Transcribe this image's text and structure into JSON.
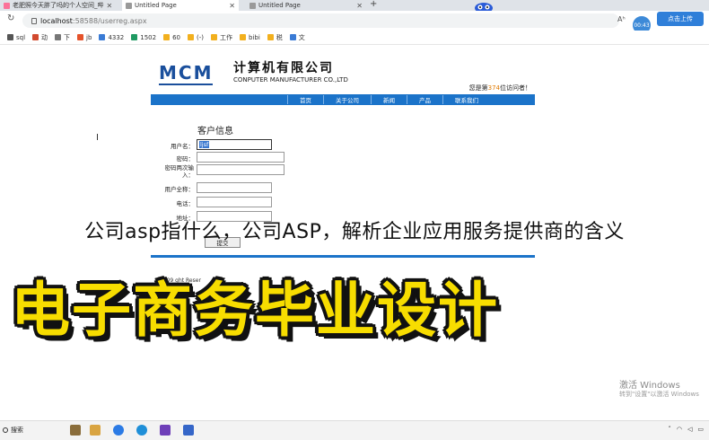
{
  "browser": {
    "tabs": [
      {
        "title": "老肥照今天胖了吗的个人空间_哔"
      },
      {
        "title": "Untitled Page"
      },
      {
        "title": "Untitled Page"
      }
    ],
    "new_tab": "+",
    "url_host": "localhost",
    "url_path": ":58588/userreg.aspx",
    "aa_label": "Aʰ",
    "ext_badge": "00:43",
    "upload_button": "点击上传",
    "bookmarks": [
      "sql",
      "动",
      "下",
      "jb",
      "4332",
      "1502",
      "60",
      "(-)",
      "工作",
      "bibi",
      "税",
      "文"
    ]
  },
  "site": {
    "logo": "MCM",
    "company_name": "计算机有限公司",
    "company_name_en": "CONPUTER MANUFACTURER CO.,LTD",
    "visit_prefix": "您是第",
    "visit_count": "374",
    "visit_suffix": "位访问者！",
    "nav": [
      "首页",
      "关于公司",
      "新闻",
      "产品",
      "联系我们"
    ],
    "form_title": "客户信息",
    "fields": [
      {
        "label": "用户名：",
        "value": "ljsf"
      },
      {
        "label": "密码：",
        "value": ""
      },
      {
        "label": "密码两次输入：",
        "value": ""
      },
      {
        "label": "用户全称：",
        "value": ""
      },
      {
        "label": "电话：",
        "value": ""
      },
      {
        "label": "地址：",
        "value": ""
      }
    ],
    "submit": "提交",
    "footer_line1": "8-2009    ght Reser",
    "footer_line2": "版权所有    f0"
  },
  "overlay": {
    "subtitle": "公司asp指什么，公司ASP，解析企业应用服务提供商的含义",
    "banner": "电子商务毕业设计"
  },
  "watermark": {
    "line1": "激活 Windows",
    "line2": "转到\"设置\"以激活 Windows"
  },
  "taskbar": {
    "search": "搜索"
  },
  "colors": {
    "nav_blue": "#1b73c9",
    "logo_blue": "#1a4f9c",
    "banner_yellow": "#f7dd00",
    "visit_orange": "#e07a00"
  }
}
